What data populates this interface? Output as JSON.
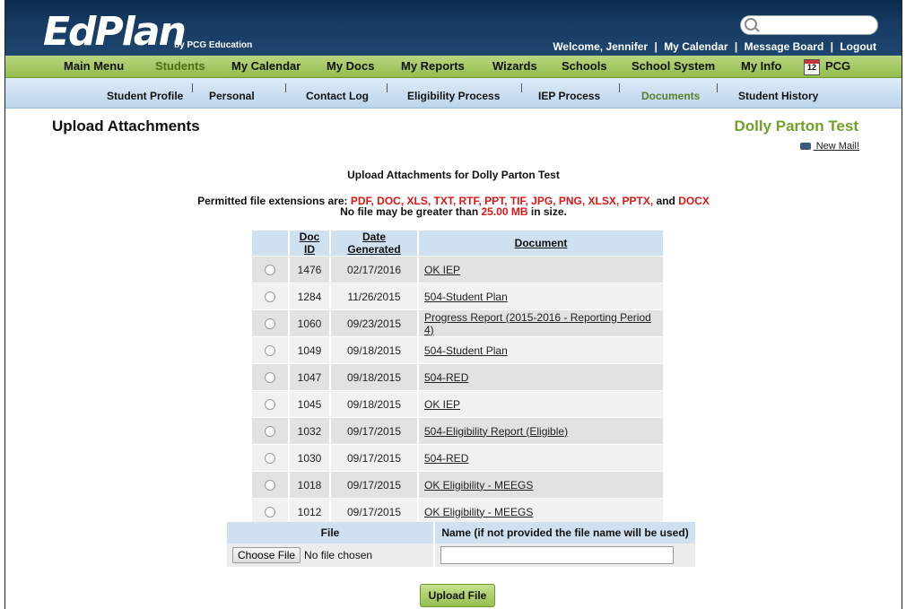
{
  "header": {
    "logo_main": "EdPlan",
    "logo_sub": "by PCG Education",
    "links": [
      "Welcome, Jennifer",
      "My Calendar",
      "Message Board",
      "Logout"
    ],
    "separator": "|"
  },
  "main_menu": [
    {
      "label": "Main Menu"
    },
    {
      "label": "Students",
      "active": true
    },
    {
      "label": "My Calendar"
    },
    {
      "label": "My Docs"
    },
    {
      "label": "My Reports"
    },
    {
      "label": "Wizards"
    },
    {
      "label": "Schools"
    },
    {
      "label": "School System"
    },
    {
      "label": "My Info"
    },
    {
      "label": "PCG"
    }
  ],
  "calendar_icon_text": "12",
  "sub_menu": [
    {
      "label": "Student Profile"
    },
    {
      "label": "Personal"
    },
    {
      "label": "Contact Log"
    },
    {
      "label": "Eligibility Process"
    },
    {
      "label": "IEP Process"
    },
    {
      "label": "Documents",
      "active": true
    },
    {
      "label": "Student History"
    }
  ],
  "page": {
    "title": "Upload Attachments",
    "student_name": "Dolly Parton Test",
    "mail_link": " New Mail!",
    "subheading": "Upload Attachments for Dolly Parton Test",
    "permitted_prefix": "Permitted file extensions are: ",
    "extensions": "PDF, DOC, XLS, TXT, RTF, PPT, TIF, JPG, PNG, XLSX, PPTX,",
    "and_text": " and ",
    "last_extension": "DOCX",
    "limit_prefix": "No file may be greater than ",
    "limit_value": "25.00 MB",
    "limit_suffix": " in size."
  },
  "documents_table": {
    "headers": [
      "Doc ID",
      "Date Generated",
      "Document"
    ],
    "rows": [
      {
        "id": "1476",
        "date": "02/17/2016",
        "doc": "OK IEP"
      },
      {
        "id": "1284",
        "date": "11/26/2015",
        "doc": "504-Student Plan"
      },
      {
        "id": "1060",
        "date": "09/23/2015",
        "doc": "Progress Report (2015-2016 - Reporting Period 4)"
      },
      {
        "id": "1049",
        "date": "09/18/2015",
        "doc": "504-Student Plan"
      },
      {
        "id": "1047",
        "date": "09/18/2015",
        "doc": "504-RED"
      },
      {
        "id": "1045",
        "date": "09/18/2015",
        "doc": "OK IEP"
      },
      {
        "id": "1032",
        "date": "09/17/2015",
        "doc": "504-Eligibility Report (Eligible)"
      },
      {
        "id": "1030",
        "date": "09/17/2015",
        "doc": "504-RED"
      },
      {
        "id": "1018",
        "date": "09/17/2015",
        "doc": "OK Eligibility - MEEGS"
      },
      {
        "id": "1012",
        "date": "09/17/2015",
        "doc": "OK Eligibility - MEEGS"
      }
    ]
  },
  "upload": {
    "file_header": "File",
    "name_header": "Name (if not provided the file name will be used)",
    "choose_label": "Choose File",
    "no_file_text": "No file chosen",
    "name_value": "",
    "button_label": "Upload File"
  },
  "colors": {
    "header_dark": "#163a62",
    "nav_green": "#a6c964",
    "nav_blue": "#c9dcef",
    "student_green": "#71a12a",
    "highlight_red": "#e01515"
  }
}
